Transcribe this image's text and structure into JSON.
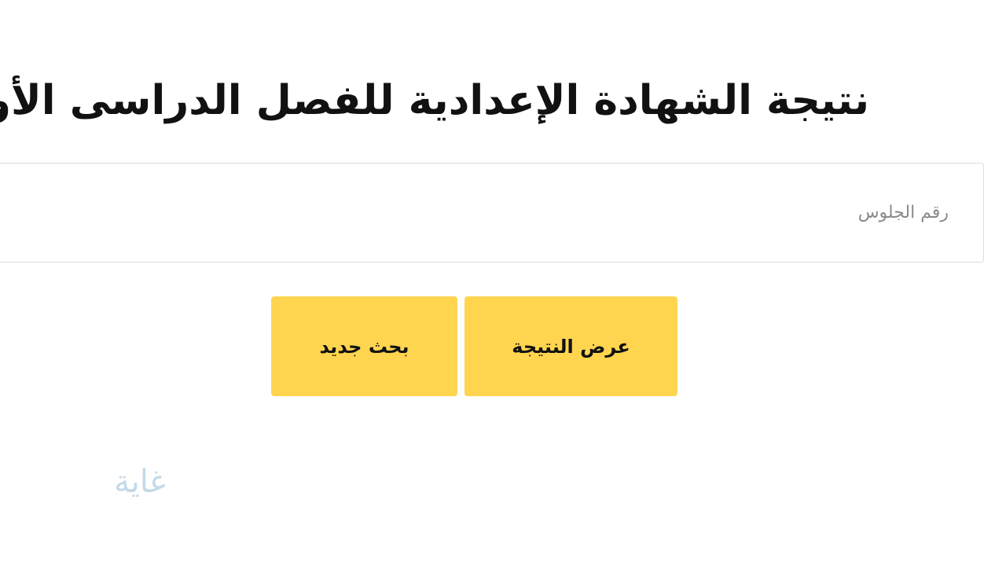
{
  "page": {
    "title": "نتيجة الشهادة الإعدادية للفصل الدراسى الأول"
  },
  "form": {
    "seat_number": {
      "placeholder": "رقم الجلوس",
      "value": ""
    },
    "show_result_label": "عرض النتيجة",
    "new_search_label": "بحث جديد"
  },
  "watermark": {
    "text": "غاية"
  },
  "colors": {
    "button_bg": "#ffd54f",
    "title_text": "#111111",
    "input_border": "#dcdcdc",
    "placeholder_text": "#8a8a8a",
    "watermark": "#b9d3e6"
  }
}
